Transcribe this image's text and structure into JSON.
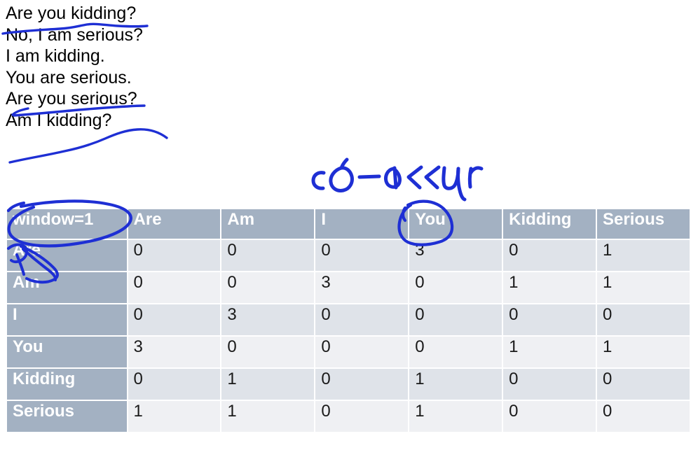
{
  "document": {
    "sentences": [
      "Are you kidding?",
      "No, I am serious?",
      "I am kidding.",
      "You are serious.",
      "Are you serious?",
      "Am I kidding?"
    ]
  },
  "annotations": {
    "handwritten_label": "co-occur",
    "ink_color": "#1e2fd4",
    "marks": [
      {
        "name": "underline-are-you-line1",
        "target": "Are you"
      },
      {
        "name": "strikethrough-you-are-line4",
        "target": "You are"
      },
      {
        "name": "curve-am-to-you-line5-6",
        "target": "Am I / Are you"
      },
      {
        "name": "oval-window-header",
        "target": "window=1"
      },
      {
        "name": "arrow-are-row-label",
        "target": "Are"
      },
      {
        "name": "circle-you-column-header",
        "target": "You"
      }
    ]
  },
  "matrix": {
    "corner_label": "window=1",
    "columns": [
      "Are",
      "Am",
      "I",
      "You",
      "Kidding",
      "Serious"
    ],
    "rows": [
      {
        "label": "Are",
        "values": [
          "0",
          "0",
          "0",
          "3",
          "0",
          "1"
        ]
      },
      {
        "label": "Am",
        "values": [
          "0",
          "0",
          "3",
          "0",
          "1",
          "1"
        ]
      },
      {
        "label": "I",
        "values": [
          "0",
          "3",
          "0",
          "0",
          "0",
          "0"
        ]
      },
      {
        "label": "You",
        "values": [
          "3",
          "0",
          "0",
          "0",
          "1",
          "1"
        ]
      },
      {
        "label": "Kidding",
        "values": [
          "0",
          "1",
          "0",
          "1",
          "0",
          "0"
        ]
      },
      {
        "label": "Serious",
        "values": [
          "1",
          "1",
          "0",
          "1",
          "0",
          "0"
        ]
      }
    ],
    "colors": {
      "header_bg": "#a3b1c2",
      "header_fg": "#ffffff",
      "row_odd_bg": "#dfe3e9",
      "row_even_bg": "#eff0f3",
      "cell_fg": "#1a1a1a"
    }
  }
}
